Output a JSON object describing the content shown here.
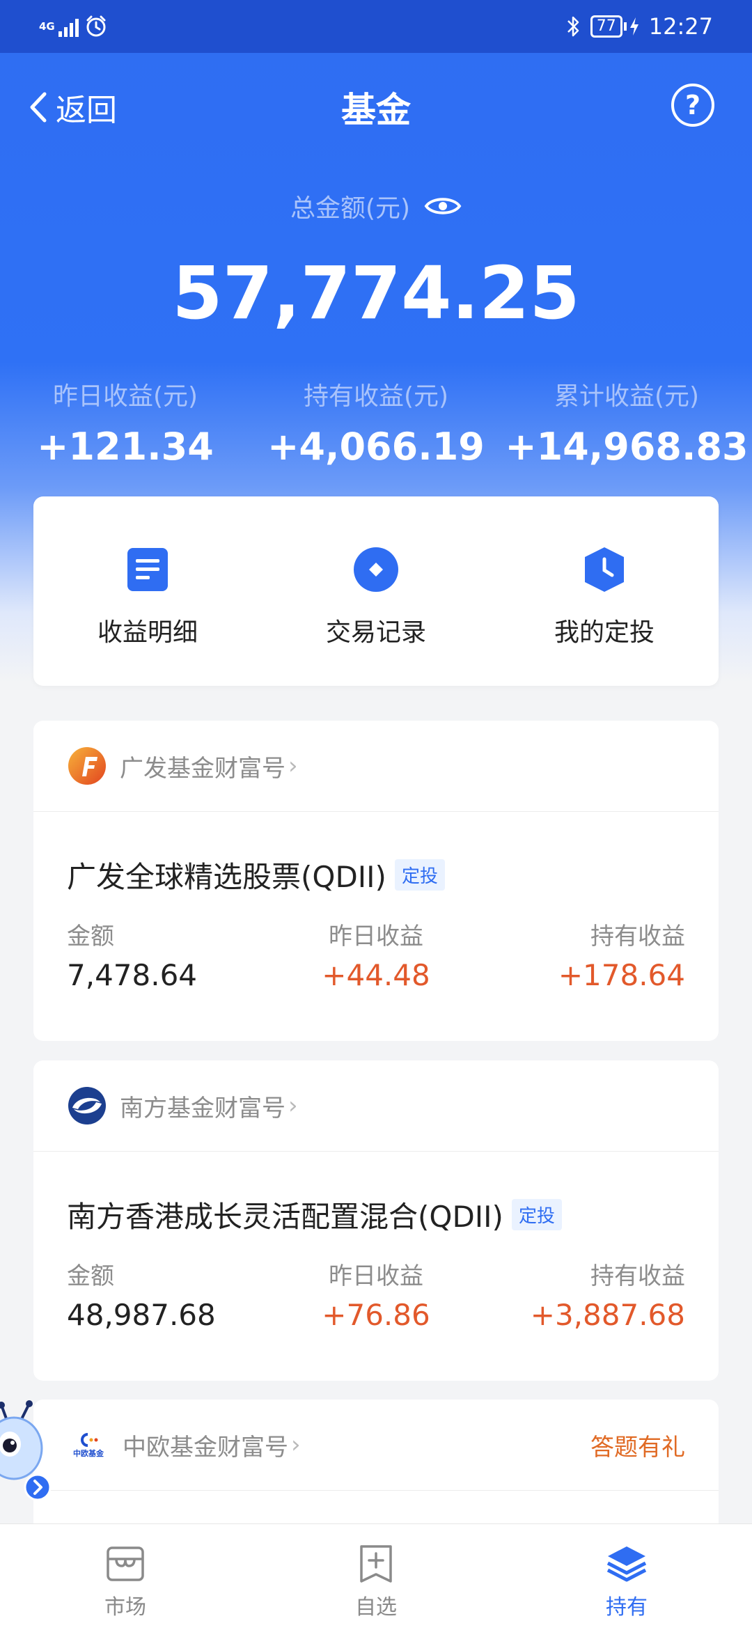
{
  "status_bar": {
    "network": "4G",
    "battery": "77",
    "time": "12:27"
  },
  "header": {
    "back_label": "返回",
    "title": "基金",
    "help_symbol": "?"
  },
  "summary": {
    "total_label": "总金额(元)",
    "total_value": "57,774.25",
    "stats": [
      {
        "label": "昨日收益(元)",
        "value": "+121.34"
      },
      {
        "label": "持有收益(元)",
        "value": "+4,066.19"
      },
      {
        "label": "累计收益(元)",
        "value": "+14,968.83"
      }
    ]
  },
  "quick_actions": [
    {
      "label": "收益明细",
      "icon": "document-icon"
    },
    {
      "label": "交易记录",
      "icon": "diamond-circle-icon"
    },
    {
      "label": "我的定投",
      "icon": "clock-shield-icon"
    }
  ],
  "funds": [
    {
      "provider": "广发基金财富号",
      "name": "广发全球精选股票(QDII)",
      "tag": "定投",
      "labels": {
        "amount": "金额",
        "yesterday": "昨日收益",
        "holding": "持有收益"
      },
      "amount": "7,478.64",
      "yesterday": "+44.48",
      "holding": "+178.64"
    },
    {
      "provider": "南方基金财富号",
      "name": "南方香港成长灵活配置混合(QDII)",
      "tag": "定投",
      "labels": {
        "amount": "金额",
        "yesterday": "昨日收益",
        "holding": "持有收益"
      },
      "amount": "48,987.68",
      "yesterday": "+76.86",
      "holding": "+3,887.68"
    },
    {
      "provider": "中欧基金财富号",
      "promo": "答题有礼",
      "logo_text": "中欧基金"
    }
  ],
  "tabbar": [
    {
      "label": "市场",
      "active": false
    },
    {
      "label": "自选",
      "active": false
    },
    {
      "label": "持有",
      "active": true
    }
  ],
  "colors": {
    "primary": "#2f6df2",
    "gain": "#e2592b",
    "status_bar": "#1f4fcf"
  }
}
